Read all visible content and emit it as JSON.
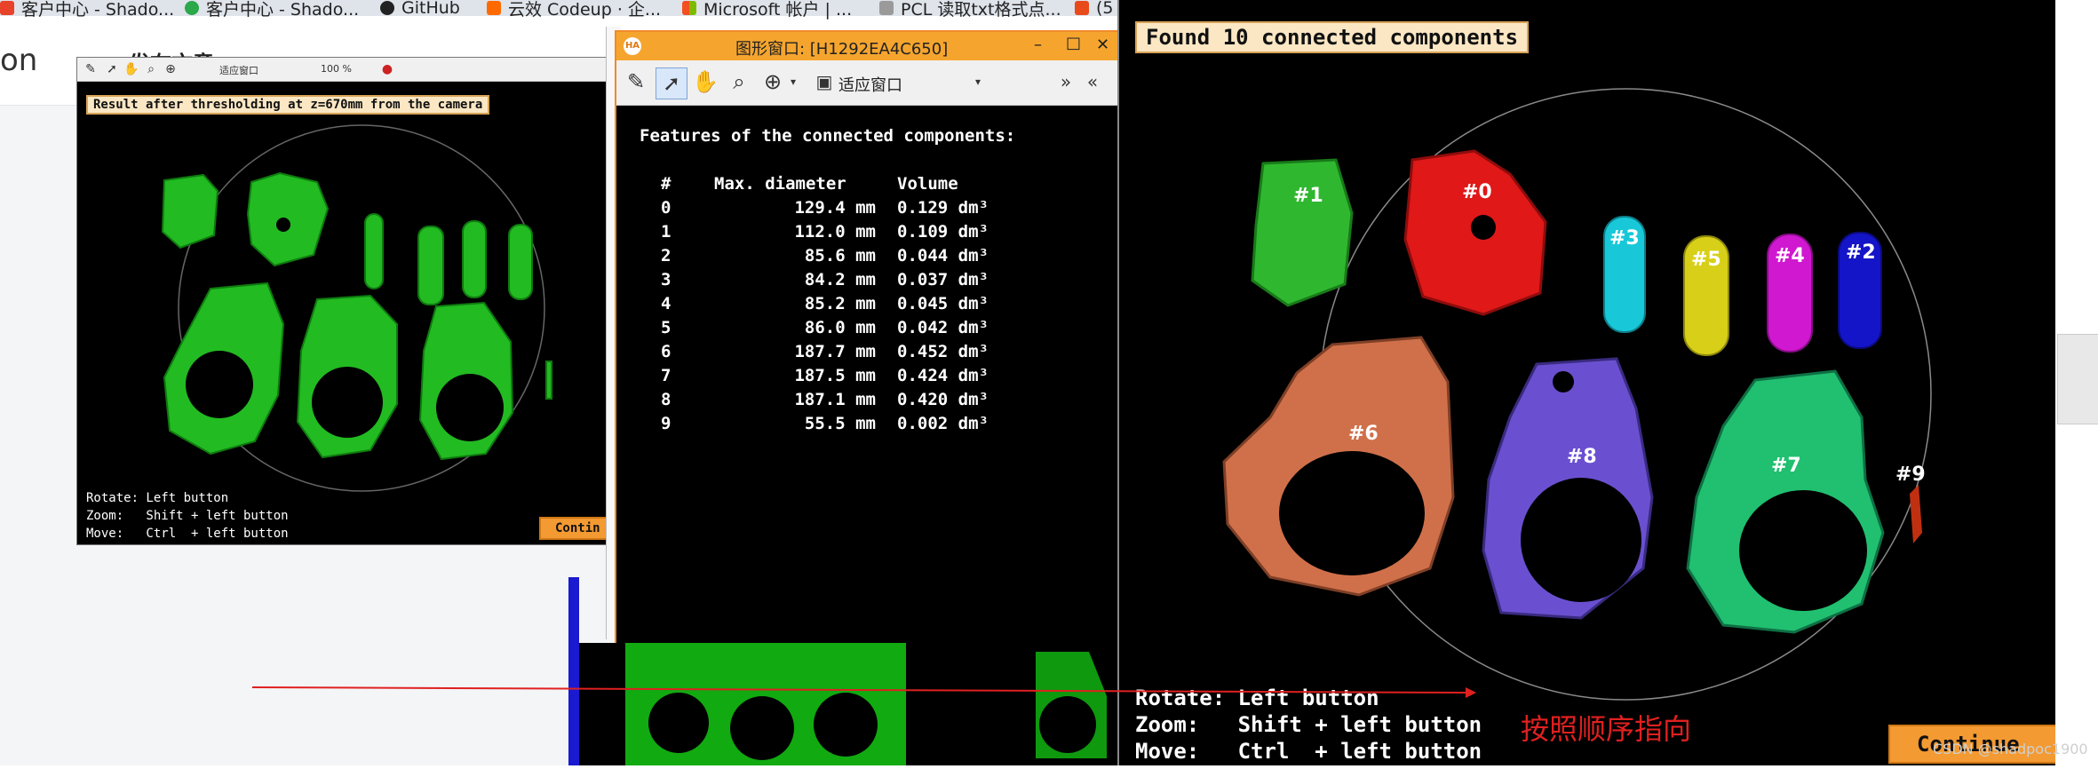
{
  "bookmarks": [
    {
      "label": "客户中心 - Shado...",
      "color": "#e8432a"
    },
    {
      "label": "客户中心 - Shado...",
      "color": "#2aa84a"
    },
    {
      "label": "GitHub",
      "color": "#222222"
    },
    {
      "label": "云效 Codeup · 企...",
      "color": "#ff6a00"
    },
    {
      "label": "Microsoft 帐户 | ...",
      "color": "#0078d4"
    },
    {
      "label": "PCL 读取txt格式点...",
      "color": "#7a7a7a"
    },
    {
      "label": "(5",
      "color": "#e84a1a"
    }
  ],
  "background_page": {
    "brand_fragment": "on",
    "publish_label": "发布文章",
    "dropdown_glyph": "▾"
  },
  "small_window": {
    "banner": "Result after thresholding at z=670mm from the camera",
    "toolbar_zoom": "100 %",
    "toolbar_fit": "适应窗口",
    "hints": [
      "Rotate: Left button",
      "Zoom:   Shift + left button",
      "Move:   Ctrl  + left button"
    ],
    "continue_label": "Contin"
  },
  "graphics_window": {
    "title": "图形窗口: [H1292EA4C650]",
    "logo": "HA",
    "fit_label": "适应窗口",
    "min_glyph": "–",
    "max_glyph": "□",
    "close_glyph": "✕",
    "heading": "Features of the connected components:",
    "table": {
      "headers": [
        "#",
        "Max. diameter",
        "Volume"
      ],
      "rows": [
        [
          "0",
          "129.4 mm",
          "0.129 dm³"
        ],
        [
          "1",
          "112.0 mm",
          "0.109 dm³"
        ],
        [
          "2",
          "85.6 mm",
          "0.044 dm³"
        ],
        [
          "3",
          "84.2 mm",
          "0.037 dm³"
        ],
        [
          "4",
          "85.2 mm",
          "0.045 dm³"
        ],
        [
          "5",
          "86.0 mm",
          "0.042 dm³"
        ],
        [
          "6",
          "187.7 mm",
          "0.452 dm³"
        ],
        [
          "7",
          "187.5 mm",
          "0.424 dm³"
        ],
        [
          "8",
          "187.1 mm",
          "0.420 dm³"
        ],
        [
          "9",
          "55.5 mm",
          "0.002 dm³"
        ]
      ]
    }
  },
  "main_window": {
    "banner": "Found 10 connected components",
    "labels": [
      "#0",
      "#1",
      "#2",
      "#3",
      "#4",
      "#5",
      "#6",
      "#7",
      "#8",
      "#9"
    ],
    "hints": [
      "Rotate: Left button",
      "Zoom:   Shift + left button",
      "Move:   Ctrl  + left button"
    ],
    "continue_label": "Continue",
    "colors": {
      "c0": "#e01818",
      "c1": "#2fb82f",
      "c2": "#1414c8",
      "c3": "#18c8d8",
      "c4": "#d018d0",
      "c5": "#d8d018",
      "c6": "#d0704a",
      "c7": "#20c070",
      "c8": "#6a50d0",
      "c9": "#c03010"
    }
  },
  "annotation": {
    "text": "按照顺序指向",
    "color": "#e02020"
  },
  "watermark": "CSDN @shadpoc1900"
}
